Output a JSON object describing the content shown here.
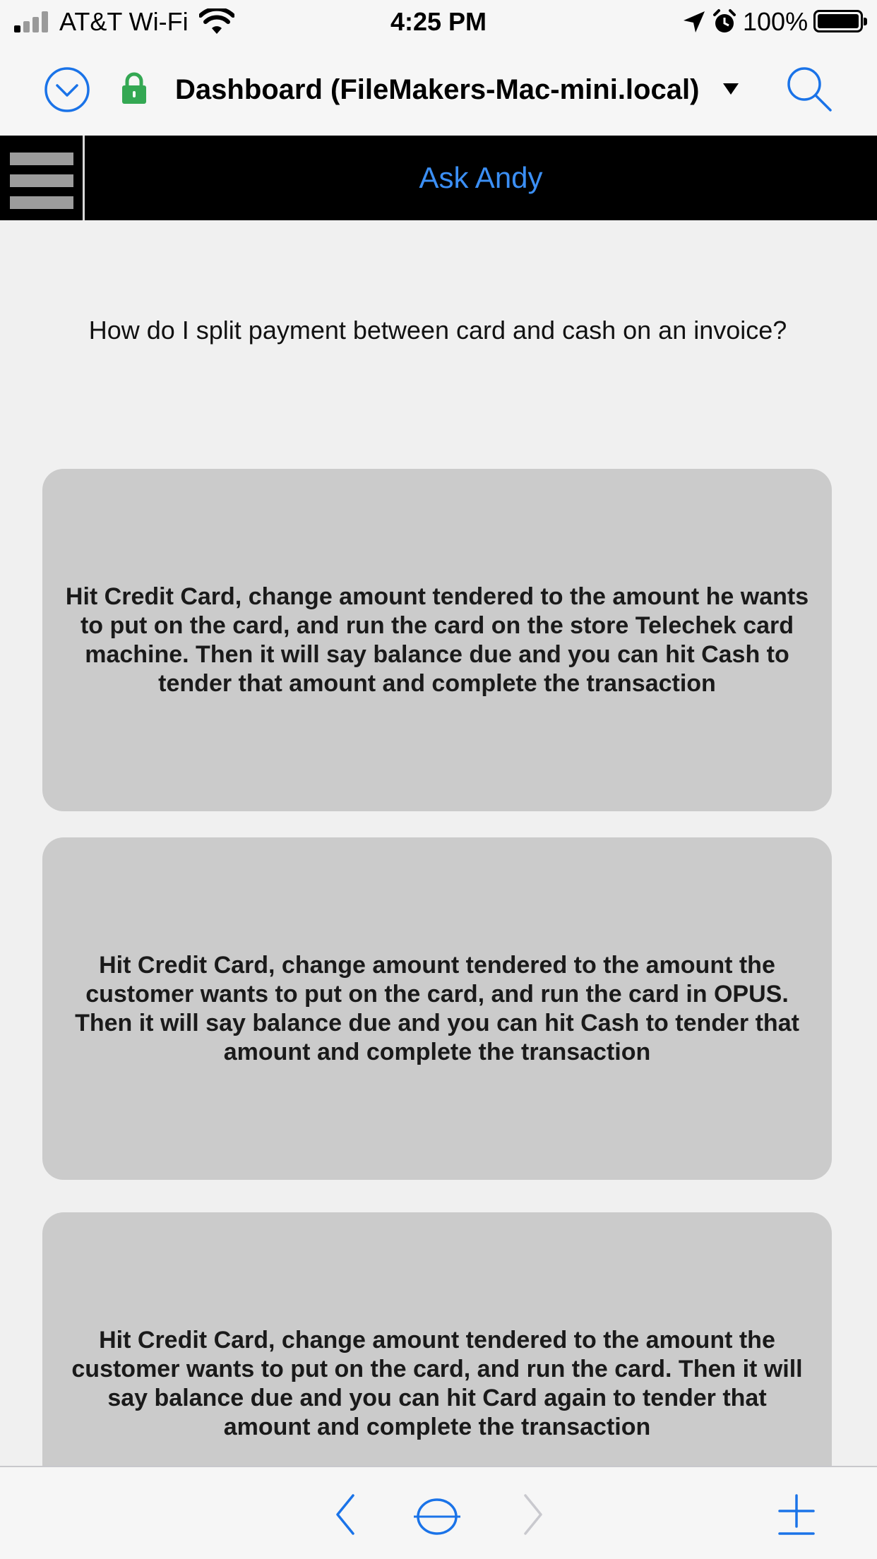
{
  "status_bar": {
    "carrier": "AT&T Wi-Fi",
    "time": "4:25 PM",
    "battery": "100%",
    "icons": [
      "signal-icon",
      "wifi-icon",
      "location-arrow-icon",
      "alarm-icon",
      "battery-icon"
    ]
  },
  "nav": {
    "title": "Dashboard (FileMakers-Mac-mini.local)",
    "icons": [
      "chevron-down-circle-icon",
      "lock-icon",
      "dropdown-caret-icon",
      "search-icon"
    ],
    "accent_color": "#1a73e8",
    "lock_color": "#34a853"
  },
  "header": {
    "title": "Ask Andy",
    "title_color": "#3b8ff5",
    "icons": [
      "hamburger-menu-icon"
    ]
  },
  "question": "How do I split payment between card and cash on an invoice?",
  "answers": [
    "Hit Credit Card, change amount tendered to the amount he wants to put on the card, and run the card on the store Telechek card machine. Then it will say balance due and you can hit Cash to tender that amount and complete the transaction",
    "Hit Credit Card, change amount tendered to the amount the customer wants to put on the card, and run the card in OPUS. Then it will say balance due and you can hit Cash to tender that amount and complete the transaction",
    "Hit Credit Card, change amount tendered to the amount the customer wants to put on the card, and run the card. Then it will say balance due and you can hit Card again to tender that amount and complete the transaction"
  ],
  "toolbar": {
    "icons": [
      "back-icon",
      "home-icon",
      "forward-icon",
      "add-icon"
    ]
  }
}
